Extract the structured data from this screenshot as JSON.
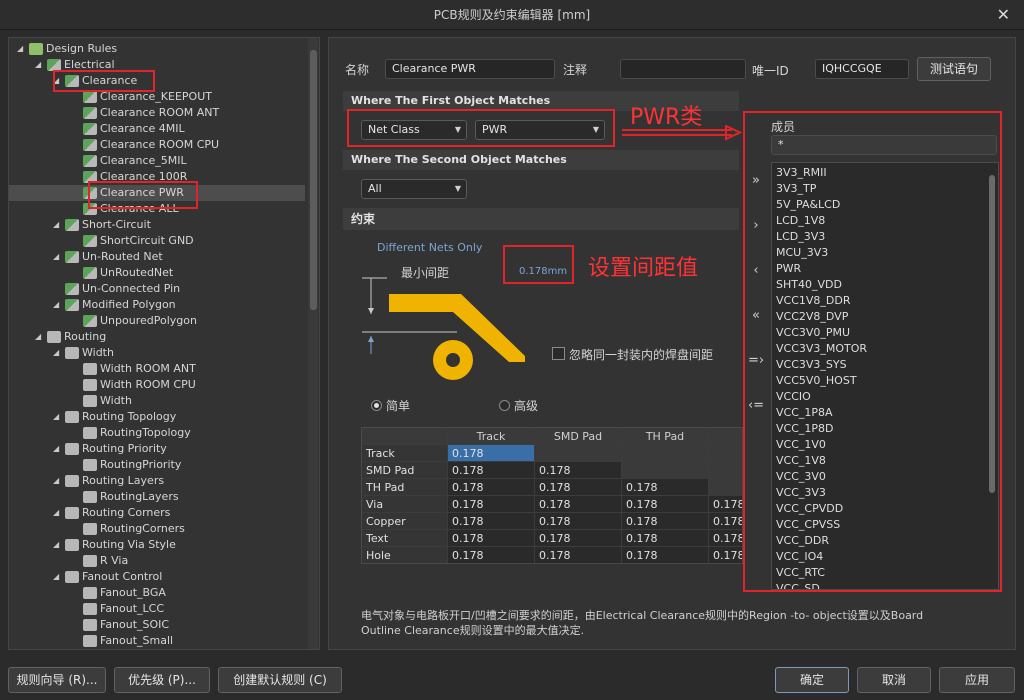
{
  "window": {
    "title": "PCB规则及约束编辑器 [mm]",
    "close_glyph": "✕"
  },
  "tree": [
    {
      "label": "Design Rules",
      "level": 0,
      "expander": "◢",
      "icon": "root"
    },
    {
      "label": "Electrical",
      "level": 1,
      "expander": "◢",
      "icon": "rule"
    },
    {
      "label": "Clearance",
      "level": 2,
      "expander": "◢",
      "icon": "rule"
    },
    {
      "label": "Clearance_KEEPOUT",
      "level": 3,
      "expander": "",
      "icon": "rule"
    },
    {
      "label": "Clearance ROOM ANT",
      "level": 3,
      "expander": "",
      "icon": "rule"
    },
    {
      "label": "Clearance 4MIL",
      "level": 3,
      "expander": "",
      "icon": "rule"
    },
    {
      "label": "Clearance ROOM CPU",
      "level": 3,
      "expander": "",
      "icon": "rule"
    },
    {
      "label": "Clearance_5MIL",
      "level": 3,
      "expander": "",
      "icon": "rule"
    },
    {
      "label": "Clearance 100R",
      "level": 3,
      "expander": "",
      "icon": "rule"
    },
    {
      "label": "Clearance PWR",
      "level": 3,
      "expander": "",
      "icon": "rule",
      "selected": true
    },
    {
      "label": "Clearance ALL",
      "level": 3,
      "expander": "",
      "icon": "rule"
    },
    {
      "label": "Short-Circuit",
      "level": 2,
      "expander": "◢",
      "icon": "rule"
    },
    {
      "label": "ShortCircuit GND",
      "level": 3,
      "expander": "",
      "icon": "rule"
    },
    {
      "label": "Un-Routed Net",
      "level": 2,
      "expander": "◢",
      "icon": "rule"
    },
    {
      "label": "UnRoutedNet",
      "level": 3,
      "expander": "",
      "icon": "rule"
    },
    {
      "label": "Un-Connected Pin",
      "level": 2,
      "expander": "",
      "icon": "rule"
    },
    {
      "label": "Modified Polygon",
      "level": 2,
      "expander": "◢",
      "icon": "rule"
    },
    {
      "label": "UnpouredPolygon",
      "level": 3,
      "expander": "",
      "icon": "rule"
    },
    {
      "label": "Routing",
      "level": 1,
      "expander": "◢",
      "icon": "folder"
    },
    {
      "label": "Width",
      "level": 2,
      "expander": "◢",
      "icon": "folder"
    },
    {
      "label": "Width ROOM ANT",
      "level": 3,
      "expander": "",
      "icon": "folder"
    },
    {
      "label": "Width ROOM CPU",
      "level": 3,
      "expander": "",
      "icon": "folder"
    },
    {
      "label": "Width",
      "level": 3,
      "expander": "",
      "icon": "folder"
    },
    {
      "label": "Routing Topology",
      "level": 2,
      "expander": "◢",
      "icon": "folder"
    },
    {
      "label": "RoutingTopology",
      "level": 3,
      "expander": "",
      "icon": "folder"
    },
    {
      "label": "Routing Priority",
      "level": 2,
      "expander": "◢",
      "icon": "folder"
    },
    {
      "label": "RoutingPriority",
      "level": 3,
      "expander": "",
      "icon": "folder"
    },
    {
      "label": "Routing Layers",
      "level": 2,
      "expander": "◢",
      "icon": "folder"
    },
    {
      "label": "RoutingLayers",
      "level": 3,
      "expander": "",
      "icon": "folder"
    },
    {
      "label": "Routing Corners",
      "level": 2,
      "expander": "◢",
      "icon": "folder"
    },
    {
      "label": "RoutingCorners",
      "level": 3,
      "expander": "",
      "icon": "folder"
    },
    {
      "label": "Routing Via Style",
      "level": 2,
      "expander": "◢",
      "icon": "folder"
    },
    {
      "label": "R Via",
      "level": 3,
      "expander": "",
      "icon": "folder"
    },
    {
      "label": "Fanout Control",
      "level": 2,
      "expander": "◢",
      "icon": "folder"
    },
    {
      "label": "Fanout_BGA",
      "level": 3,
      "expander": "",
      "icon": "folder"
    },
    {
      "label": "Fanout_LCC",
      "level": 3,
      "expander": "",
      "icon": "folder"
    },
    {
      "label": "Fanout_SOIC",
      "level": 3,
      "expander": "",
      "icon": "folder"
    },
    {
      "label": "Fanout_Small",
      "level": 3,
      "expander": "",
      "icon": "folder"
    }
  ],
  "header": {
    "name_label": "名称",
    "name_value": "Clearance PWR",
    "comment_label": "注释",
    "comment_value": "",
    "uid_label": "唯一ID",
    "uid_value": "IQHCCGQE",
    "test_button": "测试语句"
  },
  "first_match": {
    "title": "Where The First Object Matches",
    "type_value": "Net Class",
    "value": "PWR",
    "annotation": "PWR类"
  },
  "second_match": {
    "title": "Where The Second Object Matches",
    "value": "All"
  },
  "constraints": {
    "title": "约束",
    "different_nets": "Different Nets Only",
    "min_clearance_label": "最小间距",
    "min_clearance_value": "0.178mm",
    "annotation": "设置间距值",
    "ignore_label": "忽略同一封装内的焊盘间距",
    "ignore_checked": false,
    "mode_simple": "简单",
    "mode_advanced": "高级",
    "selected_mode": "simple"
  },
  "members": {
    "title": "成员",
    "filter": "*",
    "items": [
      "3V3_RMII",
      "3V3_TP",
      "5V_PA&LCD",
      "LCD_1V8",
      "LCD_3V3",
      "MCU_3V3",
      "PWR",
      "SHT40_VDD",
      "VCC1V8_DDR",
      "VCC2V8_DVP",
      "VCC3V0_PMU",
      "VCC3V3_MOTOR",
      "VCC3V3_SYS",
      "VCC5V0_HOST",
      "VCCIO",
      "VCC_1P8A",
      "VCC_1P8D",
      "VCC_1V0",
      "VCC_1V8",
      "VCC_3V0",
      "VCC_3V3",
      "VCC_CPVDD",
      "VCC_CPVSS",
      "VCC_DDR",
      "VCC_IO4",
      "VCC_RTC",
      "VCC_SD"
    ]
  },
  "transfer_buttons": [
    "»",
    "›",
    "‹",
    "«",
    "=›",
    "‹="
  ],
  "table": {
    "columns": [
      "",
      "Track",
      "SMD Pad",
      "TH Pad",
      ""
    ],
    "rows": [
      {
        "name": "Track",
        "cells": [
          "0.178",
          "",
          "",
          ""
        ]
      },
      {
        "name": "SMD Pad",
        "cells": [
          "0.178",
          "0.178",
          "",
          ""
        ]
      },
      {
        "name": "TH Pad",
        "cells": [
          "0.178",
          "0.178",
          "0.178",
          ""
        ]
      },
      {
        "name": "Via",
        "cells": [
          "0.178",
          "0.178",
          "0.178",
          "0.178"
        ]
      },
      {
        "name": "Copper",
        "cells": [
          "0.178",
          "0.178",
          "0.178",
          "0.178"
        ]
      },
      {
        "name": "Text",
        "cells": [
          "0.178",
          "0.178",
          "0.178",
          "0.178"
        ]
      },
      {
        "name": "Hole",
        "cells": [
          "0.178",
          "0.178",
          "0.178",
          "0.178"
        ]
      }
    ]
  },
  "description": [
    "电气对象与电路板开口/凹槽之间要求的间距，由Electrical Clearance规则中的Region -to- object设置以及Board",
    "Outline Clearance规则设置中的最大值决定."
  ],
  "footer": {
    "wizard": "规则向导 (R)...",
    "priority": "优先级 (P)...",
    "create_default": "创建默认规则 (C)",
    "ok": "确定",
    "cancel": "取消",
    "apply": "应用"
  },
  "colors": {
    "annotation_red": "#e0242a",
    "selection_blue": "#3a6ea8",
    "copper": "#f0b400"
  }
}
